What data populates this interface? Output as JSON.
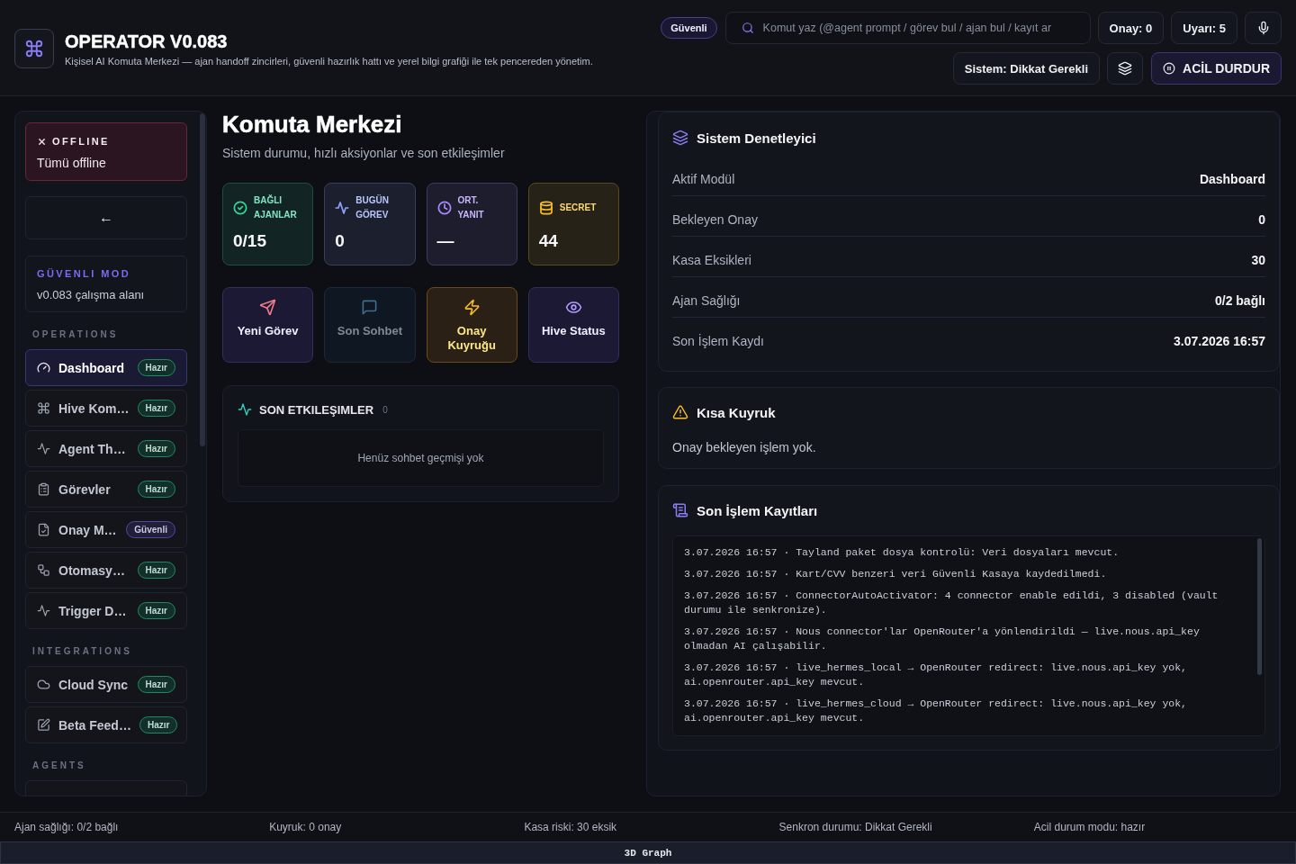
{
  "header": {
    "title": "OPERATOR V0.083",
    "subtitle": "Kişisel AI Komuta Merkezi — ajan handoff zincirleri, güvenli hazırlık hattı ve yerel bilgi grafiği ile tek pencereden yönetim.",
    "mode_pill": "Güvenli",
    "search": {
      "placeholder": "Komut yaz (@agent prompt / görev bul / ajan bul / kayıt ar"
    },
    "counters": [
      "Onay: 0",
      "Uyarı: 5"
    ],
    "system_status": "Sistem: Dikkat Gerekli",
    "stop_button": "ACİL DURDUR"
  },
  "sidebar": {
    "offline": {
      "title": "OFFLINE",
      "text": "Tümü offline"
    },
    "back_button": "←",
    "mode": {
      "title": "GÜVENLI MOD",
      "text": "v0.083 çalışma alanı"
    },
    "sections": [
      {
        "title": "OPERATIONS",
        "items": [
          {
            "kind": "full",
            "label": "Dashboard",
            "selected": true,
            "badge": {
              "text": "Hazır",
              "color": "#1f8a63"
            }
          },
          {
            "kind": "full",
            "label": "Hive Kom…",
            "selected": false,
            "badge": {
              "text": "Hazır",
              "color": "#1f8a63"
            }
          },
          {
            "kind": "full",
            "label": "Agent Th…",
            "selected": false,
            "badge": {
              "text": "Hazır",
              "color": "#1f8a63"
            }
          },
          {
            "kind": "full",
            "label": "Görevler",
            "selected": false,
            "badge": {
              "text": "Hazır",
              "color": "#1f8a63"
            }
          },
          {
            "kind": "full",
            "label": "Onay M…",
            "selected": false,
            "badge": {
              "text": "Güvenli",
              "color": "#5546a0"
            }
          },
          {
            "kind": "full",
            "label": "Otomasy…",
            "selected": false,
            "badge": {
              "text": "Hazır",
              "color": "#1f8a63"
            }
          },
          {
            "kind": "full",
            "label": "Trigger D…",
            "selected": false,
            "badge": {
              "text": "Hazır",
              "color": "#1f8a63"
            }
          }
        ]
      },
      {
        "title": "INTEGRATIONS",
        "items": [
          {
            "kind": "full",
            "label": "Cloud Sync",
            "selected": false,
            "badge": {
              "text": "Hazır",
              "color": "#1f8a63"
            }
          },
          {
            "kind": "full",
            "label": "Beta Feed…",
            "selected": false,
            "badge": {
              "text": "Hazır",
              "color": "#1f8a63"
            }
          }
        ]
      },
      {
        "title": "AGENTS",
        "items": [
          {
            "kind": "cut",
            "selected": false
          }
        ]
      }
    ]
  },
  "page": {
    "title": "Komuta Merkezi",
    "subtitle": "Sistem durumu, hızlı aksiyonlar ve son etkileşimler",
    "stats": [
      {
        "label": "BAĞLI AJANLAR",
        "value": "0/15",
        "color": "#34d399"
      },
      {
        "label": "BUGÜN GÖREV",
        "value": "0",
        "color": "#8ea2f8"
      },
      {
        "label": "ORT. YANIT",
        "value": "—",
        "color": "#a78bfa"
      },
      {
        "label": "SECRET",
        "value": "44",
        "color": "#fbbf24"
      }
    ],
    "actions": [
      {
        "label": "Yeni Görev",
        "color": "#f47c8a",
        "kind": "accent",
        "disabled": false
      },
      {
        "label": "Son Sohbet",
        "color": "#3d6d8f",
        "kind": "muted",
        "disabled": true
      },
      {
        "label": "Onay Kuyruğu",
        "color": "#fbbf24",
        "kind": "warning",
        "disabled": false
      },
      {
        "label": "Hive Status",
        "color": "#b49cfc",
        "kind": "accent",
        "disabled": false
      }
    ],
    "interactions": {
      "title": "SON ETKILEŞIMLER",
      "count": "0",
      "empty": "Henüz sohbet geçmişi yok"
    }
  },
  "inspector": {
    "title": "Sistem Denetleyici",
    "rows": [
      {
        "label": "Aktif Modül",
        "value": "Dashboard"
      },
      {
        "label": "Bekleyen Onay",
        "value": "0"
      },
      {
        "label": "Kasa Eksikleri",
        "value": "30"
      },
      {
        "label": "Ajan Sağlığı",
        "value": "0/2 bağlı"
      },
      {
        "label": "Son İşlem Kaydı",
        "value": "3.07.2026 16:57"
      }
    ]
  },
  "queue": {
    "title": "Kısa Kuyruk",
    "text": "Onay bekleyen işlem yok."
  },
  "logs": {
    "title": "Son İşlem Kayıtları",
    "entries": [
      "3.07.2026 16:57 · Tayland paket dosya kontrolü: Veri dosyaları mevcut.",
      "3.07.2026 16:57 · Kart/CVV benzeri veri Güvenli Kasaya kaydedilmedi.",
      "3.07.2026 16:57 · ConnectorAutoActivator: 4 connector enable edildi, 3 disabled (vault durumu ile senkronize).",
      "3.07.2026 16:57 · Nous connector'lar OpenRouter'a yönlendirildi — live.nous.api_key olmadan AI çalışabilir.",
      "3.07.2026 16:57 · live_hermes_local → OpenRouter redirect: live.nous.api_key yok, ai.openrouter.api_key mevcut.",
      "3.07.2026 16:57 · live_hermes_cloud → OpenRouter redirect: live.nous.api_key yok, ai.openrouter.api_key mevcut."
    ]
  },
  "status_bar": [
    "Ajan sağlığı: 0/2 bağlı",
    "Kuyruk: 0 onay",
    "Kasa riski: 30 eksik",
    "Senkron durumu: Dikkat Gerekli",
    "Acil durum modu: hazır"
  ],
  "graph_button": "3D Graph"
}
